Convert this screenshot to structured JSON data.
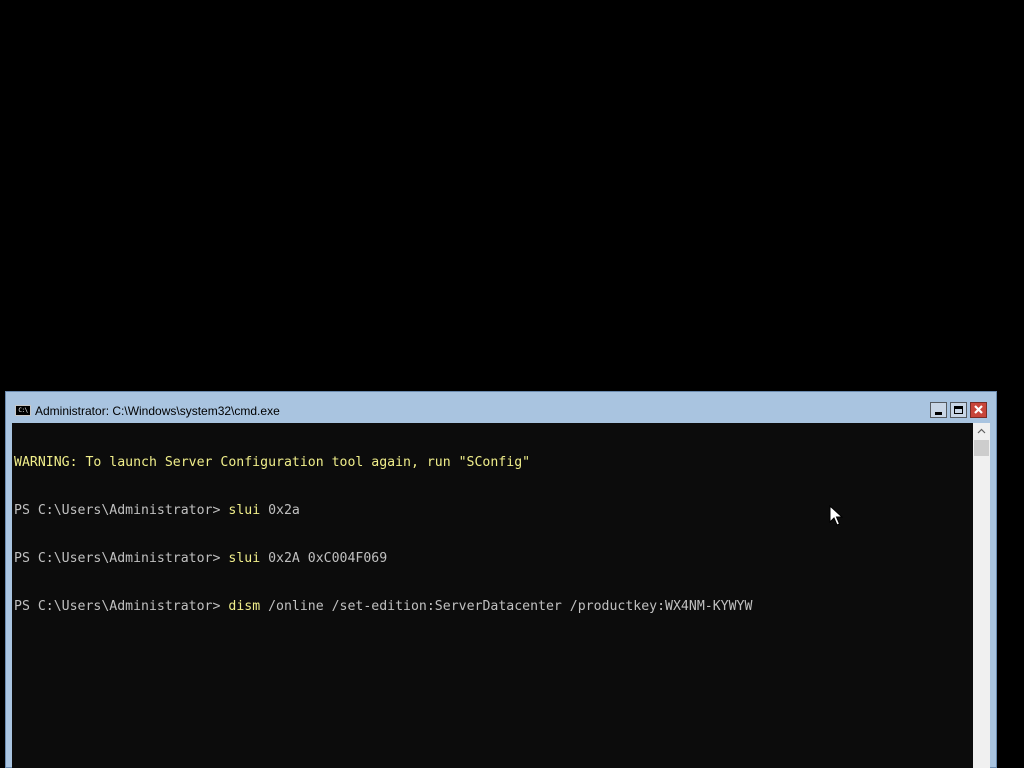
{
  "window": {
    "title": "Administrator: C:\\Windows\\system32\\cmd.exe",
    "icon_text": "C:\\",
    "icon": "console-app-icon",
    "buttons": [
      "minimize-icon",
      "maximize-icon",
      "close-icon"
    ]
  },
  "console": {
    "lines": [
      {
        "warning": "WARNING: To launch Server Configuration tool again, run \"SConfig\""
      },
      {
        "prompt": "PS C:\\Users\\Administrator> ",
        "command": "slui",
        "args": " 0x2a"
      },
      {
        "prompt": "PS C:\\Users\\Administrator> ",
        "command": "slui",
        "args": " 0x2A 0xC004F069"
      },
      {
        "prompt": "PS C:\\Users\\Administrator> ",
        "command": "dism",
        "args": " /online /set-edition:ServerDatacenter /productkey:WX4NM-KYWYW"
      }
    ]
  },
  "colors": {
    "console_background": "#0c0c0c",
    "warning_text": "#f0ee8a",
    "command_text": "#f0ee8a",
    "default_text": "#c0c0c0",
    "title_bar": "#a9c4e0",
    "close_button": "#c8453a"
  }
}
